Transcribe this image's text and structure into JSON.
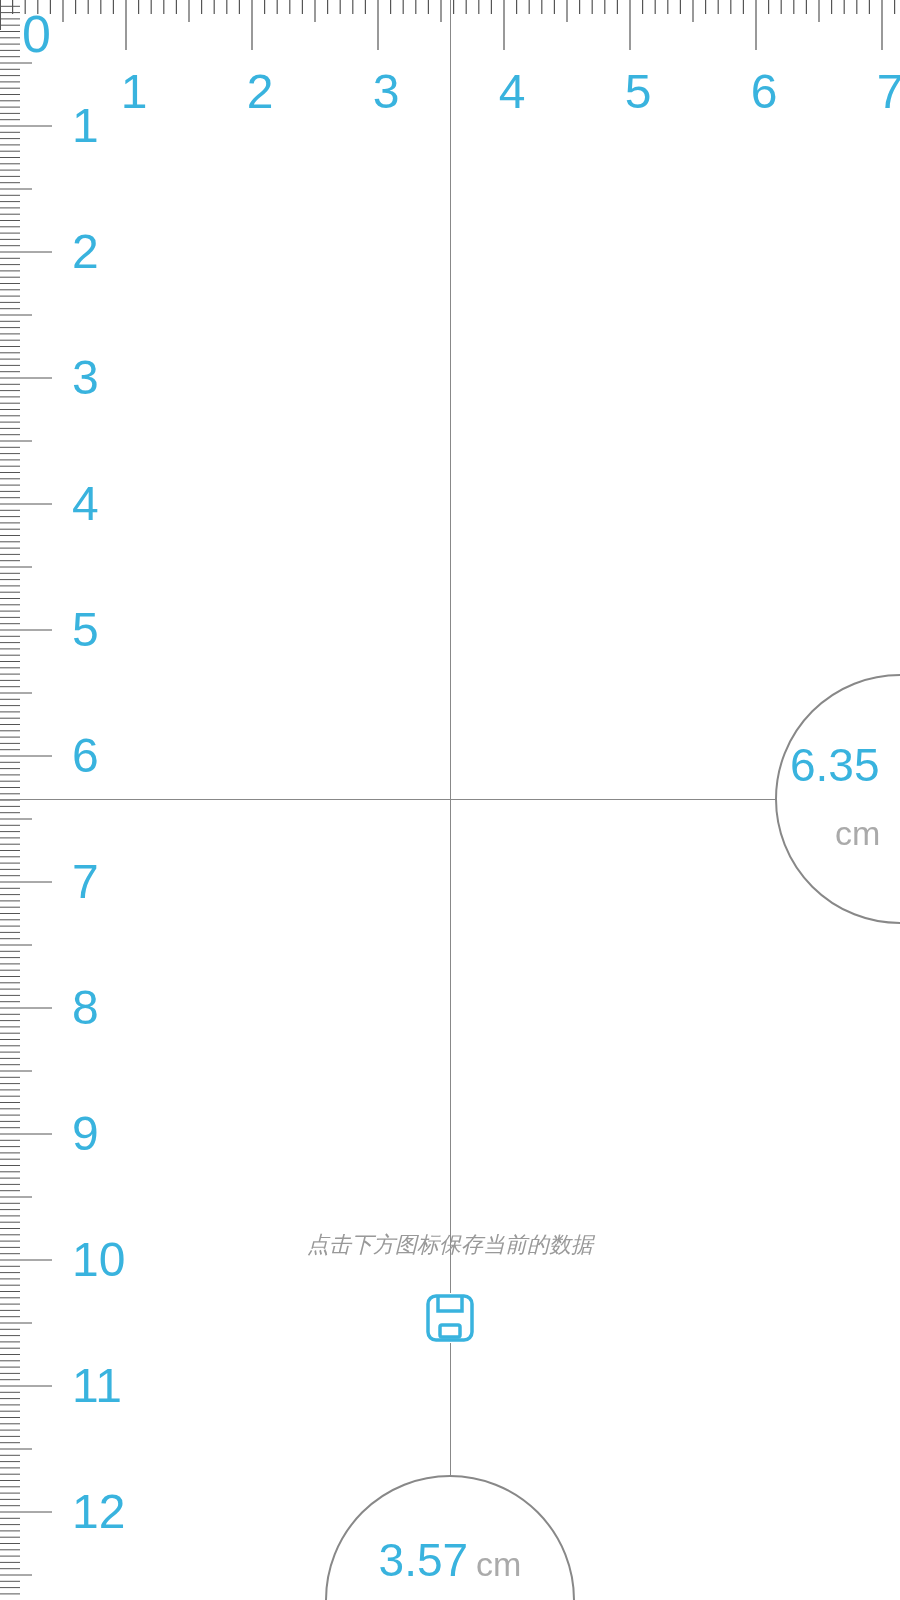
{
  "top_ruler": {
    "origin": "0",
    "labels": [
      "1",
      "2",
      "3",
      "4",
      "5",
      "6",
      "7"
    ]
  },
  "side_ruler": {
    "labels": [
      "1",
      "2",
      "3",
      "4",
      "5",
      "6",
      "7",
      "8",
      "9",
      "10",
      "11",
      "12"
    ]
  },
  "vertical_reading": {
    "value": "6.35",
    "unit": "cm"
  },
  "horizontal_reading": {
    "value": "3.57",
    "unit": "cm"
  },
  "hint": "点击下方图标保存当前的数据"
}
